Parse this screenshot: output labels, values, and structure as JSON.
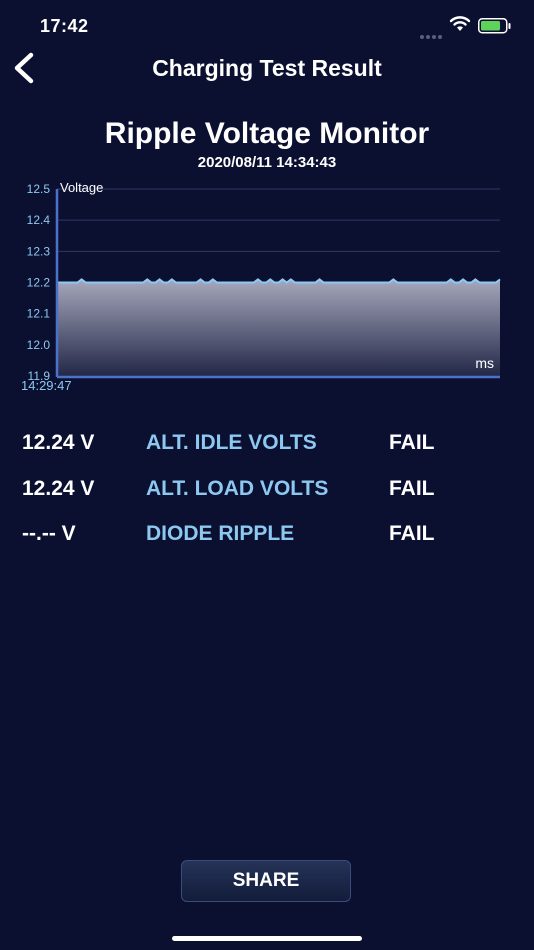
{
  "status_bar": {
    "time": "17:42",
    "wifi_icon": "wifi-icon",
    "battery_icon": "battery-icon",
    "battery_color": "#5ed35a"
  },
  "nav": {
    "back_icon": "chevron-left-icon",
    "title": "Charging Test Result"
  },
  "monitor": {
    "title": "Ripple Voltage Monitor",
    "datetime": "2020/08/11 14:34:43"
  },
  "chart_data": {
    "type": "area",
    "title": "",
    "ylabel": "Voltage",
    "xlabel": "ms",
    "ylim": [
      11.9,
      12.5
    ],
    "yticks": [
      "12.5",
      "12.4",
      "12.3",
      "12.2",
      "12.1",
      "12.0",
      "11.9"
    ],
    "x_start_label": "14:29:47",
    "grid": true,
    "line_color": "#8ccaf5",
    "series": [
      {
        "values": [
          12.2,
          12.2,
          12.2,
          12.2,
          12.2,
          12.2,
          12.21,
          12.2,
          12.2,
          12.2,
          12.2,
          12.2,
          12.2,
          12.2,
          12.2,
          12.2,
          12.2,
          12.2,
          12.2,
          12.2,
          12.2,
          12.2,
          12.21,
          12.2,
          12.2,
          12.21,
          12.2,
          12.2,
          12.21,
          12.2,
          12.2,
          12.2,
          12.2,
          12.2,
          12.2,
          12.21,
          12.2,
          12.2,
          12.21,
          12.2,
          12.2,
          12.2,
          12.2,
          12.2,
          12.2,
          12.2,
          12.2,
          12.2,
          12.2,
          12.21,
          12.2,
          12.2,
          12.21,
          12.2,
          12.2,
          12.21,
          12.2,
          12.21,
          12.2,
          12.2,
          12.2,
          12.2,
          12.2,
          12.2,
          12.21,
          12.2,
          12.2,
          12.2,
          12.2,
          12.2,
          12.2,
          12.2,
          12.2,
          12.2,
          12.2,
          12.2,
          12.2,
          12.2,
          12.2,
          12.2,
          12.2,
          12.2,
          12.21,
          12.2,
          12.2,
          12.2,
          12.2,
          12.2,
          12.2,
          12.2,
          12.2,
          12.2,
          12.2,
          12.2,
          12.2,
          12.2,
          12.21,
          12.2,
          12.2,
          12.21,
          12.2,
          12.2,
          12.21,
          12.2,
          12.2,
          12.2,
          12.2,
          12.2,
          12.21
        ]
      }
    ]
  },
  "results": [
    {
      "reading": "12.24 V",
      "name": "ALT. IDLE VOLTS",
      "status": "FAIL"
    },
    {
      "reading": "12.24 V",
      "name": "ALT. LOAD VOLTS",
      "status": "FAIL"
    },
    {
      "reading": "--.-- V",
      "name": "DIODE RIPPLE",
      "status": "FAIL"
    }
  ],
  "share_button": {
    "label": "SHARE"
  },
  "colors": {
    "background": "#0c1030",
    "accent_text": "#8cc8f0",
    "axis": "#4a72c8"
  }
}
